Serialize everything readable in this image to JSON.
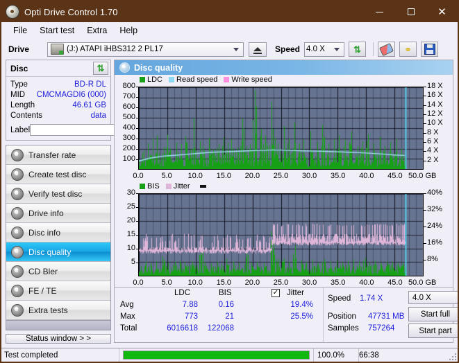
{
  "window": {
    "title": "Opti Drive Control 1.70",
    "icon": "disc-icon",
    "minimize": "—",
    "maximize": "□",
    "close": "✕"
  },
  "menu": {
    "items": [
      "File",
      "Start test",
      "Extra",
      "Help"
    ]
  },
  "toolbar": {
    "drive_label": "Drive",
    "drive_value": "(J:)  ATAPI iHBS312  2 PL17",
    "eject_icon": "eject-icon",
    "speed_label": "Speed",
    "speed_value": "4.0 X",
    "refresh_icon": "refresh-arrows-icon",
    "erase_icon": "eraser-icon",
    "keys_icon": "keys-icon",
    "save_icon": "floppy-save-icon"
  },
  "disc_panel": {
    "header": "Disc",
    "refresh_icon": "refresh-arrows-icon",
    "rows": [
      {
        "key": "Type",
        "value": "BD-R DL"
      },
      {
        "key": "MID",
        "value": "CMCMAGDI6 (000)"
      },
      {
        "key": "Length",
        "value": "46.61 GB"
      },
      {
        "key": "Contents",
        "value": "data"
      }
    ],
    "label_key": "Label",
    "label_value": "",
    "label_button_icon": "disc-icon"
  },
  "nav": {
    "items": [
      {
        "label": "Transfer rate",
        "active": false
      },
      {
        "label": "Create test disc",
        "active": false
      },
      {
        "label": "Verify test disc",
        "active": false
      },
      {
        "label": "Drive info",
        "active": false
      },
      {
        "label": "Disc info",
        "active": false
      },
      {
        "label": "Disc quality",
        "active": true
      },
      {
        "label": "CD Bler",
        "active": false
      },
      {
        "label": "FE / TE",
        "active": false
      },
      {
        "label": "Extra tests",
        "active": false
      }
    ],
    "status_window": "Status window > >"
  },
  "panel": {
    "title": "Disc quality",
    "title_icon": "disc-quality-icon"
  },
  "stats": {
    "col_headers": [
      "LDC",
      "BIS"
    ],
    "jitter_label": "Jitter",
    "jitter_checked": true,
    "rows": [
      {
        "name": "Avg",
        "ldc": "7.88",
        "bis": "0.16",
        "jitter": "19.4%"
      },
      {
        "name": "Max",
        "ldc": "773",
        "bis": "21",
        "jitter": "25.5%"
      },
      {
        "name": "Total",
        "ldc": "6016618",
        "bis": "122068",
        "jitter": ""
      }
    ],
    "speed_label": "Speed",
    "speed_value": "1.74 X",
    "position_label": "Position",
    "position_value": "47731 MB",
    "samples_label": "Samples",
    "samples_value": "757264",
    "speed_select": "4.0 X",
    "start_full": "Start full",
    "start_part": "Start part"
  },
  "statusbar": {
    "message": "Test completed",
    "progress_pct": 100.0,
    "progress_text": "100.0%",
    "elapsed": "66:38"
  },
  "colors": {
    "titlebar": "#5b3317",
    "accent": "#2020d8",
    "ldc": "#1fc21f",
    "bis": "#1fc21f",
    "read_speed": "#8fd8f2",
    "write_speed": "#ff8fdf",
    "jitter": "#e0b8d8",
    "plot_bg": "#667391",
    "progress": "#0fb70f",
    "nav_active": "#17a6e4"
  },
  "chart_data": [
    {
      "type": "area",
      "id": "ldc-chart",
      "title": "",
      "legend": [
        {
          "label": "LDC",
          "color": "#16a016"
        },
        {
          "label": "Read speed",
          "color": "#8fd8f2"
        },
        {
          "label": "Write speed",
          "color": "#ff8fdf"
        }
      ],
      "legend_position": "top-left",
      "xlabel": "GB",
      "x_unit": "GB",
      "xlim": [
        0,
        50
      ],
      "xticks": [
        0.0,
        5.0,
        10.0,
        15.0,
        20.0,
        25.0,
        30.0,
        35.0,
        40.0,
        45.0,
        50.0
      ],
      "xticklabels": [
        "0.0",
        "5.0",
        "10.0",
        "15.0",
        "20.0",
        "25.0",
        "30.0",
        "35.0",
        "40.0",
        "45.0",
        "50.0 GB"
      ],
      "ylabel": "LDC",
      "ylim": [
        0,
        800
      ],
      "yticks": [
        100,
        200,
        300,
        400,
        500,
        600,
        700,
        800
      ],
      "yticklabels": [
        "100",
        "200",
        "300",
        "400",
        "500",
        "600",
        "700",
        "800"
      ],
      "y2label": "Speed",
      "y2lim": [
        0,
        18
      ],
      "y2ticks": [
        2,
        4,
        6,
        8,
        10,
        12,
        14,
        16,
        18
      ],
      "y2ticklabels": [
        "2 X",
        "4 X",
        "6 X",
        "8 X",
        "10 X",
        "12 X",
        "14 X",
        "16 X",
        "18 X"
      ],
      "grid": true,
      "series": [
        {
          "name": "LDC",
          "color": "#16a016",
          "type": "impulse",
          "baseline_band": [
            20,
            110
          ],
          "spikes_x": [
            0.9,
            1.6,
            2.5,
            3.2,
            4.4,
            5.0,
            5.5,
            6.6,
            7.4,
            8.2,
            9.0,
            9.7,
            10.8,
            11.3,
            12.4,
            13.1,
            14.0,
            14.9,
            15.6,
            16.3,
            17.4,
            18.2,
            19.0,
            19.6,
            20.4,
            21.5,
            22.3,
            23.4,
            23.9,
            24.5,
            25.6,
            26.4,
            27.4,
            28.3,
            29.0,
            30.2,
            31.4,
            32.3,
            33.4,
            34.4,
            35.2,
            36.3,
            37.4,
            38.5,
            39.4,
            40.4,
            41.3,
            42.4,
            43.3,
            44.2,
            45.3,
            46.2
          ],
          "spikes_y": [
            185,
            250,
            300,
            330,
            215,
            335,
            200,
            260,
            245,
            320,
            190,
            500,
            275,
            225,
            305,
            195,
            245,
            310,
            260,
            290,
            210,
            495,
            230,
            240,
            773,
            390,
            330,
            660,
            305,
            250,
            420,
            300,
            455,
            250,
            290,
            370,
            265,
            430,
            250,
            290,
            330,
            285,
            365,
            225,
            270,
            340,
            250,
            315,
            230,
            265,
            300,
            200
          ]
        },
        {
          "name": "Read speed",
          "color": "#9fe0f5",
          "type": "line",
          "axis": "y2",
          "x": [
            0.0,
            1.0,
            2.0,
            3.0,
            4.0,
            5.0,
            7.0,
            9.0,
            11.0,
            13.0,
            15.0,
            17.0,
            19.0,
            21.0,
            23.0,
            25.0,
            27.0,
            29.0,
            31.0,
            33.0,
            35.0,
            37.0,
            39.0,
            41.0,
            43.0,
            45.0,
            46.8
          ],
          "y": [
            1.8,
            2.1,
            2.4,
            2.6,
            2.8,
            2.9,
            3.1,
            3.3,
            3.5,
            3.7,
            3.8,
            3.9,
            4.0,
            4.1,
            4.2,
            4.2,
            4.1,
            4.0,
            3.95,
            3.9,
            3.8,
            3.7,
            3.6,
            3.45,
            3.3,
            3.1,
            3.0
          ]
        },
        {
          "name": "End marker",
          "color": "#4de4ff",
          "type": "vline",
          "x": 46.9
        }
      ]
    },
    {
      "type": "area",
      "id": "bis-jitter-chart",
      "legend": [
        {
          "label": "BIS",
          "color": "#16a016"
        },
        {
          "label": "Jitter",
          "color": "#dfb6da"
        }
      ],
      "legend_position": "top-left",
      "xlabel": "GB",
      "xlim": [
        0,
        50
      ],
      "xticks": [
        0.0,
        5.0,
        10.0,
        15.0,
        20.0,
        25.0,
        30.0,
        35.0,
        40.0,
        45.0,
        50.0
      ],
      "xticklabels": [
        "0.0",
        "5.0",
        "10.0",
        "15.0",
        "20.0",
        "25.0",
        "30.0",
        "35.0",
        "40.0",
        "45.0",
        "50.0 GB"
      ],
      "ylabel": "BIS",
      "ylim": [
        0,
        30
      ],
      "yticks": [
        5,
        10,
        15,
        20,
        25,
        30
      ],
      "yticklabels": [
        "5",
        "10",
        "15",
        "20",
        "25",
        "30"
      ],
      "y2label": "Jitter",
      "y2lim": [
        0,
        40
      ],
      "y2ticks": [
        8,
        16,
        24,
        32,
        40
      ],
      "y2ticklabels": [
        "8%",
        "16%",
        "24%",
        "32%",
        "40%"
      ],
      "grid": true,
      "series": [
        {
          "name": "BIS",
          "color": "#16a016",
          "type": "impulse",
          "baseline_band": [
            0.5,
            3.2
          ],
          "spikes_x": [
            1.2,
            2.1,
            3.0,
            4.2,
            5.1,
            6.3,
            7.2,
            8.1,
            9.4,
            10.9,
            11.6,
            12.7,
            13.8,
            14.6,
            15.4,
            16.6,
            17.6,
            18.9,
            19.8,
            20.8,
            22.0,
            23.3,
            23.8,
            24.6,
            25.5,
            26.4,
            27.5,
            28.6,
            29.5,
            30.6,
            31.6,
            32.7,
            33.8,
            34.8,
            35.8,
            36.8,
            37.8,
            38.8,
            39.8,
            40.6,
            41.6,
            42.6,
            43.6,
            44.6,
            45.6,
            46.4
          ],
          "spikes_y": [
            5.2,
            4.6,
            5.0,
            7.2,
            4.8,
            5.1,
            5.6,
            4.9,
            5.3,
            12.4,
            5.0,
            4.6,
            5.1,
            4.4,
            6.3,
            5.2,
            4.6,
            9.1,
            4.8,
            5.0,
            4.7,
            16.2,
            7.8,
            6.2,
            6.4,
            5.1,
            10.8,
            5.6,
            5.0,
            5.9,
            4.8,
            6.1,
            5.2,
            5.6,
            4.9,
            5.4,
            5.9,
            5.1,
            6.6,
            5.0,
            5.4,
            4.8,
            5.3,
            5.0,
            4.7,
            4.9
          ]
        },
        {
          "name": "Jitter",
          "color": "#dfb6da",
          "type": "band",
          "axis": "y2",
          "segments": [
            {
              "x0": 0.0,
              "x1": 23.3,
              "lo": 12.0,
              "hi": 16.0,
              "peaks_hi": 20.5
            },
            {
              "x0": 23.3,
              "x1": 46.9,
              "lo": 16.0,
              "hi": 24.2,
              "peaks_hi": 25.5
            }
          ],
          "avg": 19.4,
          "max": 25.5
        },
        {
          "name": "End marker",
          "color": "#4de4ff",
          "type": "vline",
          "x": 46.9
        }
      ]
    }
  ]
}
